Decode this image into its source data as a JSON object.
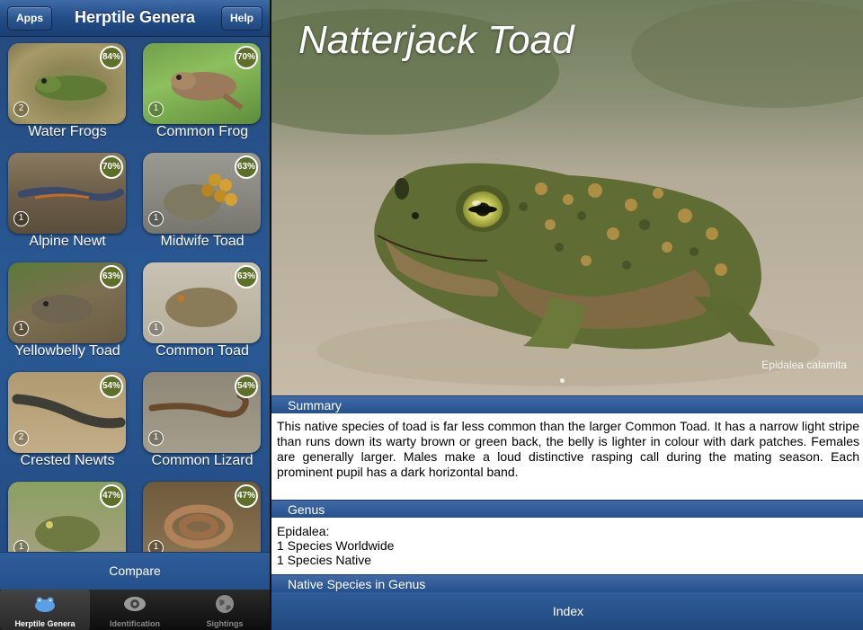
{
  "navbar": {
    "title": "Herptile Genera",
    "apps_label": "Apps",
    "help_label": "Help"
  },
  "tiles": [
    {
      "label": "Water Frogs",
      "percent": "84%",
      "count": "2"
    },
    {
      "label": "Common Frog",
      "percent": "70%",
      "count": "1"
    },
    {
      "label": "Alpine Newt",
      "percent": "70%",
      "count": "1"
    },
    {
      "label": "Midwife Toad",
      "percent": "63%",
      "count": "1"
    },
    {
      "label": "Yellowbelly Toad",
      "percent": "63%",
      "count": "1"
    },
    {
      "label": "Common Toad",
      "percent": "63%",
      "count": "1"
    },
    {
      "label": "Crested Newts",
      "percent": "54%",
      "count": "2"
    },
    {
      "label": "Common Lizard",
      "percent": "54%",
      "count": "1"
    },
    {
      "label": "",
      "percent": "47%",
      "count": "1"
    },
    {
      "label": "",
      "percent": "47%",
      "count": "1"
    }
  ],
  "compare_label": "Compare",
  "tabs": [
    {
      "label": "Herptile Genera",
      "icon": "frog-icon"
    },
    {
      "label": "Identification",
      "icon": "eye-icon"
    },
    {
      "label": "Sightings",
      "icon": "globe-icon"
    }
  ],
  "detail": {
    "title": "Natterjack Toad",
    "photo_caption": "Epidalea calamita",
    "summary_header": "Summary",
    "summary_text": "This native species of toad is far less common than the larger Common Toad. It has a narrow light stripe than runs down its warty brown or green back, the belly is lighter in colour with dark patches. Females are generally larger. Males make a loud distinctive rasping call during the mating season. Each prominent pupil has a dark horizontal band.",
    "genus_header": "Genus",
    "genus_lines": [
      "Epidalea:",
      "1 Species Worldwide",
      "1 Species Native"
    ],
    "native_header": "Native Species in Genus",
    "index_label": "Index"
  },
  "colors": {
    "nav_blue": "#234d88",
    "badge_green": "#5e6f2a",
    "section_blue": "#27518c"
  }
}
